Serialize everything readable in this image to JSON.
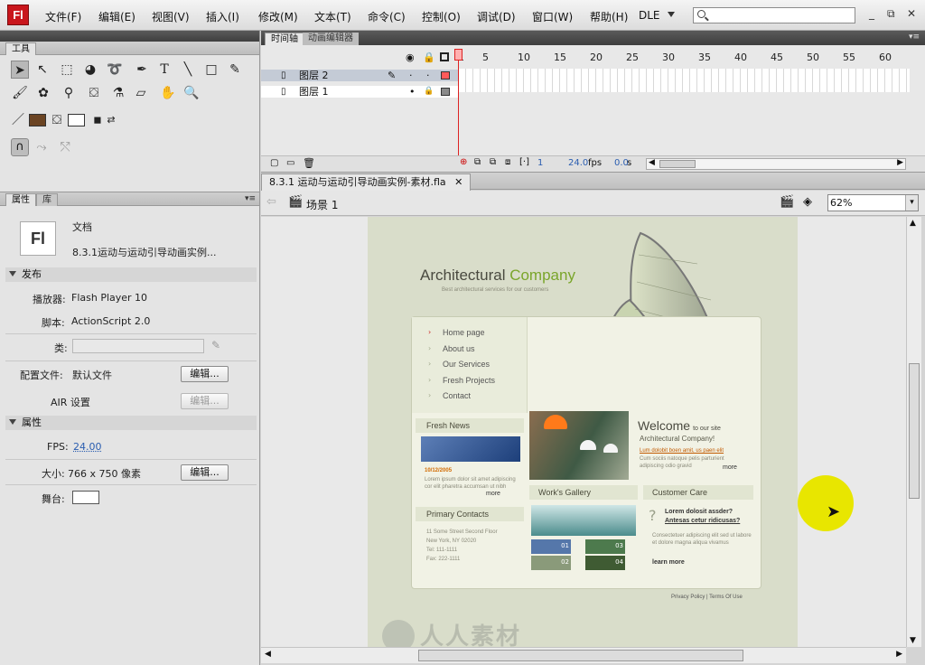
{
  "app": {
    "logo": "Fl"
  },
  "menu": {
    "items": [
      "文件(F)",
      "编辑(E)",
      "视图(V)",
      "插入(I)",
      "修改(M)",
      "文本(T)",
      "命令(C)",
      "控制(O)",
      "调试(D)",
      "窗口(W)",
      "帮助(H)"
    ],
    "workspace": "DLE",
    "window_buttons": [
      "_",
      "⧉",
      "✕"
    ]
  },
  "tools_panel": {
    "tab_label": "工具"
  },
  "properties_panel": {
    "tabs": [
      "属性",
      "库"
    ],
    "doc_type": "文档",
    "doc_icon_label": "Fl",
    "doc_name": "8.3.1运动与运动引导动画实例...",
    "publish_section": "发布",
    "player_label": "播放器:",
    "player_value": "Flash Player 10",
    "script_label": "脚本:",
    "script_value": "ActionScript 2.0",
    "class_label": "类:",
    "profile_label": "配置文件:",
    "profile_value": "默认文件",
    "edit_button": "编辑...",
    "air_label": "AIR 设置",
    "properties_section": "属性",
    "fps_label": "FPS:",
    "fps_value": "24.00",
    "size_label": "大小:",
    "size_value": "766 x 750 像素",
    "stage_label": "舞台:"
  },
  "timeline": {
    "tabs": [
      "时间轴",
      "动画编辑器"
    ],
    "layers": [
      {
        "name": "图层 2"
      },
      {
        "name": "图层 1"
      }
    ],
    "frame_numbers": [
      "1",
      "5",
      "10",
      "15",
      "20",
      "25",
      "30",
      "35",
      "40",
      "45",
      "50",
      "55",
      "60"
    ],
    "current_frame": "1",
    "fps": "24.0",
    "fps_unit": "fps",
    "time": "0.0",
    "time_unit": "s"
  },
  "document": {
    "tab_title": "8.3.1 运动与运动引导动画实例-素材.fla",
    "scene": "场景 1",
    "zoom": "62%"
  },
  "website": {
    "brand_part1": "Architectural ",
    "brand_part2": "Company",
    "tagline": "Best architectural services for our customers",
    "nav": [
      "Home page",
      "About us",
      "Our Services",
      "Fresh Projects",
      "Contact"
    ],
    "fresh_news": "Fresh News",
    "news_date": "10/12/2005",
    "news_text": "Lorem ipsum dolor sit amet adipiscing cor elit pharetra accumsan ut nibh",
    "more": "more",
    "welcome_big": "Welcome",
    "welcome_small": "to our site",
    "welcome_sub": "Architectural Company!",
    "welcome_link": "Lum dolobit boen amit, us paen elit",
    "welcome_text": "Cum sociis natoque pelis parturient adipiscing odio gravid",
    "works_gallery": "Work's Gallery",
    "customer_care": "Customer Care",
    "primary_contacts": "Primary Contacts",
    "contacts_text": [
      "11 Some Street Second Floor",
      "New York, NY 02020",
      "Tel: 111-1111",
      "Fax: 222-1111"
    ],
    "care_q1": "Lorem dolosit assder?",
    "care_q2": "Antesas cetur ridicusas?",
    "care_text": "Consectetuer adipiscing elit sed ut labore et dolore magna aliqua vivamus",
    "learn_more": "learn more",
    "gallery_nums": [
      "01",
      "03",
      "02",
      "04"
    ],
    "footer": "Privacy Policy | Terms Of Use"
  },
  "watermark": "人人素材",
  "colors": {
    "brand_red": "#c9161c",
    "brand_green": "#7aa52a",
    "highlight_yellow": "#e8e600",
    "stroke_color": "#6b4423"
  }
}
